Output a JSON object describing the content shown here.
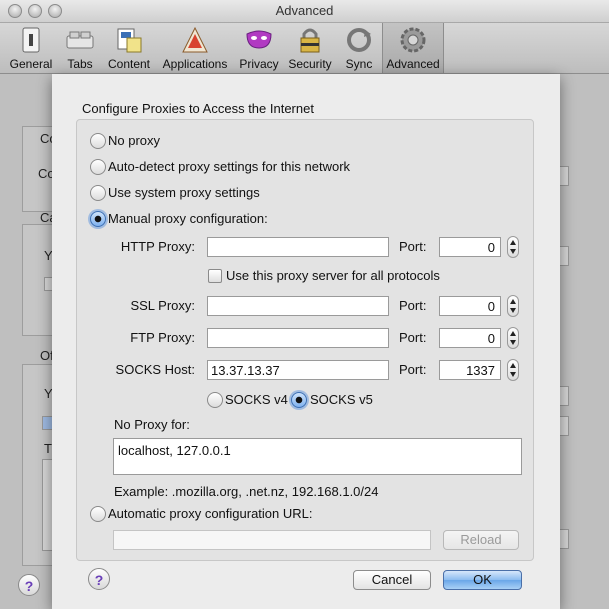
{
  "window": {
    "title": "Advanced"
  },
  "toolbar": {
    "items": [
      {
        "label": "General",
        "icon": "switch-icon"
      },
      {
        "label": "Tabs",
        "icon": "tabs-icon"
      },
      {
        "label": "Content",
        "icon": "content-icon"
      },
      {
        "label": "Applications",
        "icon": "applications-icon"
      },
      {
        "label": "Privacy",
        "icon": "mask-icon"
      },
      {
        "label": "Security",
        "icon": "lock-icon"
      },
      {
        "label": "Sync",
        "icon": "sync-icon"
      },
      {
        "label": "Advanced",
        "icon": "gear-icon",
        "selected": true
      }
    ]
  },
  "background": {
    "texts": [
      "Co",
      "Co",
      "Ca",
      "Y",
      "Of",
      "Y",
      "T"
    ]
  },
  "dialog": {
    "title": "Configure Proxies to Access the Internet",
    "options": {
      "no_proxy": "No proxy",
      "auto_detect": "Auto-detect proxy settings for this network",
      "system": "Use system proxy settings",
      "manual": "Manual proxy configuration:",
      "auto_url": "Automatic proxy configuration URL:"
    },
    "selected_option": "manual",
    "http": {
      "label": "HTTP Proxy:",
      "value": "",
      "port_label": "Port:",
      "port": "0"
    },
    "use_for_all": {
      "label": "Use this proxy server for all protocols",
      "checked": false
    },
    "ssl": {
      "label": "SSL Proxy:",
      "value": "",
      "port_label": "Port:",
      "port": "0"
    },
    "ftp": {
      "label": "FTP Proxy:",
      "value": "",
      "port_label": "Port:",
      "port": "0"
    },
    "socks": {
      "label": "SOCKS Host:",
      "value": "13.37.13.37",
      "port_label": "Port:",
      "port": "1337"
    },
    "socks_version": {
      "v4": "SOCKS v4",
      "v5": "SOCKS v5",
      "selected": "v5"
    },
    "no_proxy_for": {
      "label": "No Proxy for:",
      "value": "localhost, 127.0.0.1"
    },
    "example": "Example: .mozilla.org, .net.nz, 192.168.1.0/24",
    "auto_url_value": "",
    "reload_label": "Reload",
    "help_label": "?",
    "cancel_label": "Cancel",
    "ok_label": "OK"
  },
  "colors": {
    "accent": "#6aa6e8",
    "help_glyph": "#6a3fb8"
  }
}
